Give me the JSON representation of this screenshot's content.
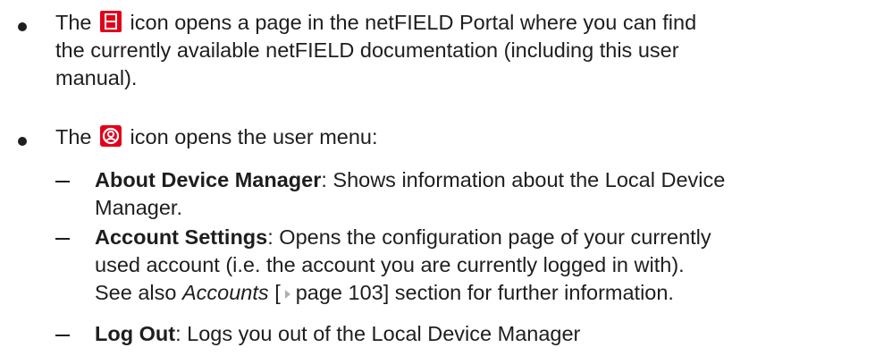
{
  "items": [
    {
      "prefix": "The",
      "icon": "documentation-icon",
      "text_line1": "icon opens a page in the netFIELD Portal where you can find",
      "text_line2": "the currently available netFIELD documentation (including this user",
      "text_line3": "manual)."
    },
    {
      "prefix": "The",
      "icon": "user-icon",
      "text_line1": "icon opens the user menu:",
      "subitems": [
        {
          "term": "About Device Manager",
          "desc_line1": ": Shows information about the Local Device",
          "desc_line2": "Manager."
        },
        {
          "term": "Account Settings",
          "desc_line1": ": Opens the configuration page of your currently",
          "desc_line2": "used account (i.e. the account you are currently logged in with).",
          "see_prefix": "See also ",
          "see_link": "Accounts",
          "see_ref": "page 103]",
          "see_bracket": "[",
          "see_suffix": " section for further information."
        },
        {
          "term": "Log Out",
          "desc_line1": ": Logs you out of the Local Device Manager"
        }
      ]
    }
  ],
  "colors": {
    "icon_red": "#e2001a",
    "text": "#1e1e1e",
    "arrow_gray": "#b0b0b0"
  }
}
